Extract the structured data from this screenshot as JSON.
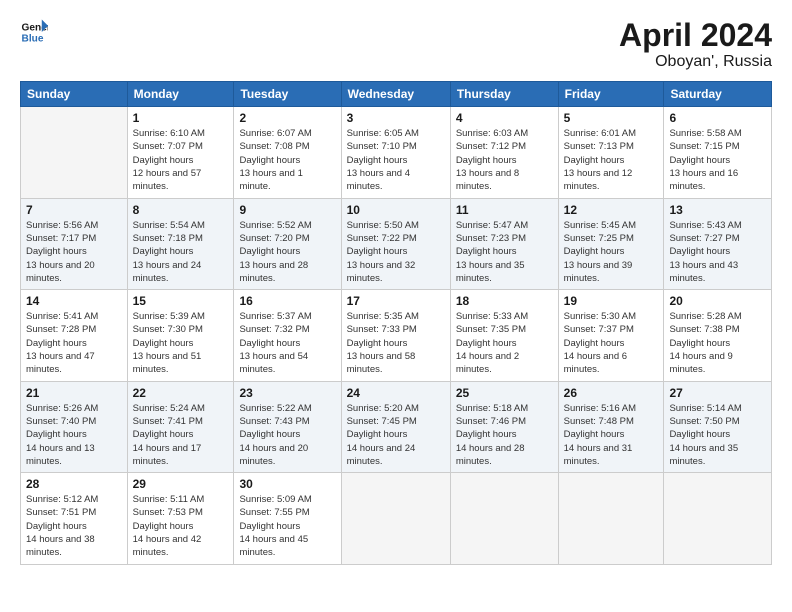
{
  "header": {
    "logo_line1": "General",
    "logo_line2": "Blue",
    "title": "April 2024",
    "subtitle": "Oboyan', Russia"
  },
  "weekdays": [
    "Sunday",
    "Monday",
    "Tuesday",
    "Wednesday",
    "Thursday",
    "Friday",
    "Saturday"
  ],
  "weeks": [
    [
      {
        "day": "",
        "empty": true
      },
      {
        "day": "1",
        "sunrise": "6:10 AM",
        "sunset": "7:07 PM",
        "daylight": "12 hours and 57 minutes."
      },
      {
        "day": "2",
        "sunrise": "6:07 AM",
        "sunset": "7:08 PM",
        "daylight": "13 hours and 1 minute."
      },
      {
        "day": "3",
        "sunrise": "6:05 AM",
        "sunset": "7:10 PM",
        "daylight": "13 hours and 4 minutes."
      },
      {
        "day": "4",
        "sunrise": "6:03 AM",
        "sunset": "7:12 PM",
        "daylight": "13 hours and 8 minutes."
      },
      {
        "day": "5",
        "sunrise": "6:01 AM",
        "sunset": "7:13 PM",
        "daylight": "13 hours and 12 minutes."
      },
      {
        "day": "6",
        "sunrise": "5:58 AM",
        "sunset": "7:15 PM",
        "daylight": "13 hours and 16 minutes."
      }
    ],
    [
      {
        "day": "7",
        "sunrise": "5:56 AM",
        "sunset": "7:17 PM",
        "daylight": "13 hours and 20 minutes."
      },
      {
        "day": "8",
        "sunrise": "5:54 AM",
        "sunset": "7:18 PM",
        "daylight": "13 hours and 24 minutes."
      },
      {
        "day": "9",
        "sunrise": "5:52 AM",
        "sunset": "7:20 PM",
        "daylight": "13 hours and 28 minutes."
      },
      {
        "day": "10",
        "sunrise": "5:50 AM",
        "sunset": "7:22 PM",
        "daylight": "13 hours and 32 minutes."
      },
      {
        "day": "11",
        "sunrise": "5:47 AM",
        "sunset": "7:23 PM",
        "daylight": "13 hours and 35 minutes."
      },
      {
        "day": "12",
        "sunrise": "5:45 AM",
        "sunset": "7:25 PM",
        "daylight": "13 hours and 39 minutes."
      },
      {
        "day": "13",
        "sunrise": "5:43 AM",
        "sunset": "7:27 PM",
        "daylight": "13 hours and 43 minutes."
      }
    ],
    [
      {
        "day": "14",
        "sunrise": "5:41 AM",
        "sunset": "7:28 PM",
        "daylight": "13 hours and 47 minutes."
      },
      {
        "day": "15",
        "sunrise": "5:39 AM",
        "sunset": "7:30 PM",
        "daylight": "13 hours and 51 minutes."
      },
      {
        "day": "16",
        "sunrise": "5:37 AM",
        "sunset": "7:32 PM",
        "daylight": "13 hours and 54 minutes."
      },
      {
        "day": "17",
        "sunrise": "5:35 AM",
        "sunset": "7:33 PM",
        "daylight": "13 hours and 58 minutes."
      },
      {
        "day": "18",
        "sunrise": "5:33 AM",
        "sunset": "7:35 PM",
        "daylight": "14 hours and 2 minutes."
      },
      {
        "day": "19",
        "sunrise": "5:30 AM",
        "sunset": "7:37 PM",
        "daylight": "14 hours and 6 minutes."
      },
      {
        "day": "20",
        "sunrise": "5:28 AM",
        "sunset": "7:38 PM",
        "daylight": "14 hours and 9 minutes."
      }
    ],
    [
      {
        "day": "21",
        "sunrise": "5:26 AM",
        "sunset": "7:40 PM",
        "daylight": "14 hours and 13 minutes."
      },
      {
        "day": "22",
        "sunrise": "5:24 AM",
        "sunset": "7:41 PM",
        "daylight": "14 hours and 17 minutes."
      },
      {
        "day": "23",
        "sunrise": "5:22 AM",
        "sunset": "7:43 PM",
        "daylight": "14 hours and 20 minutes."
      },
      {
        "day": "24",
        "sunrise": "5:20 AM",
        "sunset": "7:45 PM",
        "daylight": "14 hours and 24 minutes."
      },
      {
        "day": "25",
        "sunrise": "5:18 AM",
        "sunset": "7:46 PM",
        "daylight": "14 hours and 28 minutes."
      },
      {
        "day": "26",
        "sunrise": "5:16 AM",
        "sunset": "7:48 PM",
        "daylight": "14 hours and 31 minutes."
      },
      {
        "day": "27",
        "sunrise": "5:14 AM",
        "sunset": "7:50 PM",
        "daylight": "14 hours and 35 minutes."
      }
    ],
    [
      {
        "day": "28",
        "sunrise": "5:12 AM",
        "sunset": "7:51 PM",
        "daylight": "14 hours and 38 minutes."
      },
      {
        "day": "29",
        "sunrise": "5:11 AM",
        "sunset": "7:53 PM",
        "daylight": "14 hours and 42 minutes."
      },
      {
        "day": "30",
        "sunrise": "5:09 AM",
        "sunset": "7:55 PM",
        "daylight": "14 hours and 45 minutes."
      },
      {
        "day": "",
        "empty": true
      },
      {
        "day": "",
        "empty": true
      },
      {
        "day": "",
        "empty": true
      },
      {
        "day": "",
        "empty": true
      }
    ]
  ]
}
